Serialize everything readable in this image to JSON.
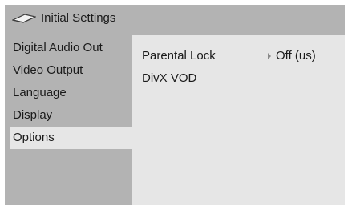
{
  "header": {
    "title": "Initial Settings",
    "icon": "disc-icon"
  },
  "sidebar": {
    "items": [
      {
        "label": "Digital Audio Out",
        "selected": false
      },
      {
        "label": "Video Output",
        "selected": false
      },
      {
        "label": "Language",
        "selected": false
      },
      {
        "label": "Display",
        "selected": false
      },
      {
        "label": "Options",
        "selected": true
      }
    ]
  },
  "options": {
    "rows": [
      {
        "label": "Parental Lock",
        "value": "Off (us)"
      },
      {
        "label": "DivX VOD",
        "value": ""
      }
    ]
  },
  "colors": {
    "frame": "#b3b3b3",
    "panel": "#e6e6e6",
    "text": "#1a1a1a"
  }
}
